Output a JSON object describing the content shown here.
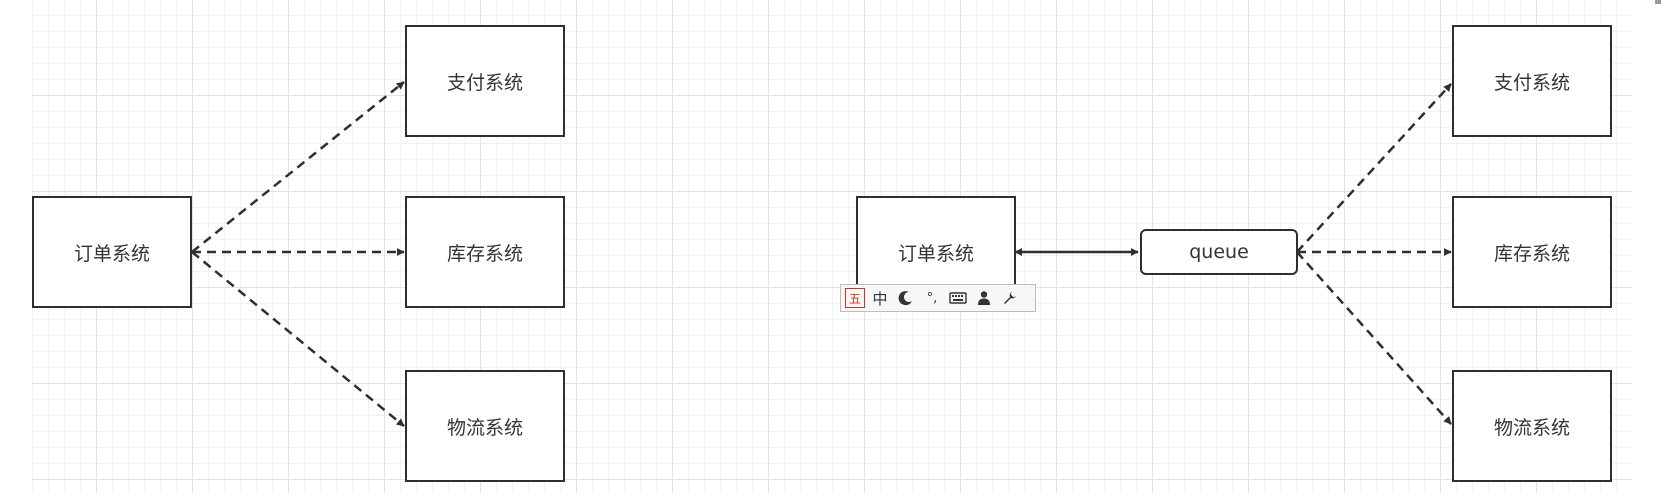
{
  "left_diagram": {
    "source": "订单系统",
    "targets": [
      "支付系统",
      "库存系统",
      "物流系统"
    ]
  },
  "right_diagram": {
    "source": "订单系统",
    "queue": "queue",
    "targets": [
      "支付系统",
      "库存系统",
      "物流系统"
    ]
  },
  "ime_toolbar": {
    "wubi": "五",
    "mode": "中",
    "icons": [
      "moon-icon",
      "punctuation-icon",
      "keyboard-icon",
      "user-icon",
      "wrench-icon"
    ],
    "punctuation": "°,"
  },
  "colors": {
    "stroke": "#2f2f2f",
    "grid_major": "#e3e3e3",
    "grid_minor": "#f1f1f1",
    "text": "#333333"
  }
}
